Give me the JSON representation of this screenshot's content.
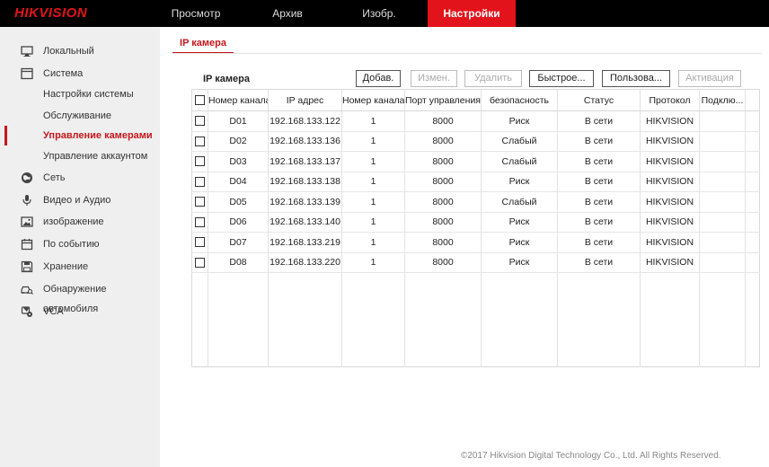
{
  "brand": {
    "logo_text": "HIKVISION",
    "accent": "#e3131b"
  },
  "nav": [
    {
      "label": "Просмотр",
      "active": false
    },
    {
      "label": "Архив",
      "active": false
    },
    {
      "label": "Изобр.",
      "active": false
    },
    {
      "label": "Настройки",
      "active": true
    }
  ],
  "sidebar": {
    "items": [
      {
        "label": "Локальный",
        "icon": "monitor-icon"
      },
      {
        "label": "Система",
        "icon": "window-icon"
      },
      {
        "label": "Сеть",
        "icon": "globe-icon"
      },
      {
        "label": "Видео и Аудио",
        "icon": "microphone-icon"
      },
      {
        "label": "изображение",
        "icon": "picture-icon"
      },
      {
        "label": "По событию",
        "icon": "calendar-icon"
      },
      {
        "label": "Хранение",
        "icon": "floppy-disk-icon"
      },
      {
        "label": "Обнаружение автомобиля",
        "icon": "car-search-icon"
      },
      {
        "label": "VCA",
        "icon": "vca-gear-icon"
      }
    ],
    "system_sub": [
      {
        "label": "Настройки системы",
        "active": false
      },
      {
        "label": "Обслуживание",
        "active": false
      },
      {
        "label": "Управление камерами",
        "active": true
      },
      {
        "label": "Управление аккаунтом",
        "active": false
      }
    ]
  },
  "tab": {
    "label": "IP камера"
  },
  "section": {
    "title": "IP камера"
  },
  "buttons": [
    {
      "label": "Добав.",
      "enabled": true
    },
    {
      "label": "Измен.",
      "enabled": false
    },
    {
      "label": "Удалить",
      "enabled": false
    },
    {
      "label": "Быстрое...",
      "enabled": true
    },
    {
      "label": "Пользова...",
      "enabled": true
    },
    {
      "label": "Активация",
      "enabled": false
    }
  ],
  "table": {
    "headers": [
      "Номер канала",
      "IP адрес",
      "Номер канала",
      "Порт управления",
      "безопасность",
      "Статус",
      "Протокол",
      "Подклю..."
    ],
    "rows": [
      [
        "D01",
        "192.168.133.122",
        "1",
        "8000",
        "Риск",
        "В сети",
        "HIKVISION",
        ""
      ],
      [
        "D02",
        "192.168.133.136",
        "1",
        "8000",
        "Слабый",
        "В сети",
        "HIKVISION",
        ""
      ],
      [
        "D03",
        "192.168.133.137",
        "1",
        "8000",
        "Слабый",
        "В сети",
        "HIKVISION",
        ""
      ],
      [
        "D04",
        "192.168.133.138",
        "1",
        "8000",
        "Риск",
        "В сети",
        "HIKVISION",
        ""
      ],
      [
        "D05",
        "192.168.133.139",
        "1",
        "8000",
        "Слабый",
        "В сети",
        "HIKVISION",
        ""
      ],
      [
        "D06",
        "192.168.133.140",
        "1",
        "8000",
        "Риск",
        "В сети",
        "HIKVISION",
        ""
      ],
      [
        "D07",
        "192.168.133.219",
        "1",
        "8000",
        "Риск",
        "В сети",
        "HIKVISION",
        ""
      ],
      [
        "D08",
        "192.168.133.220",
        "1",
        "8000",
        "Риск",
        "В сети",
        "HIKVISION",
        ""
      ]
    ]
  },
  "footer": {
    "text": "©2017 Hikvision Digital Technology Co., Ltd. All Rights Reserved."
  }
}
